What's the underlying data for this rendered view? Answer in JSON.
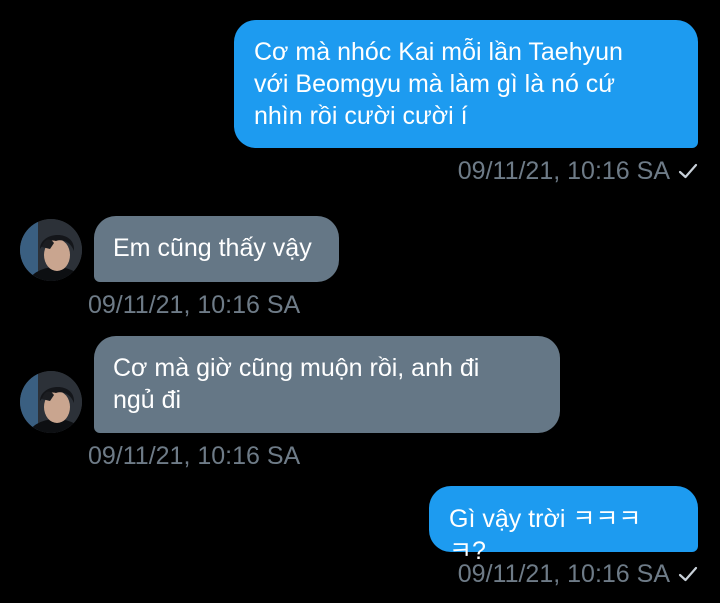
{
  "conversation": {
    "messages": [
      {
        "direction": "outgoing",
        "text": "Cơ mà nhóc Kai mỗi lần Taehyun với Beomgyu mà làm gì là nó cứ nhìn rồi cười cười í",
        "lines": [
          "Cơ mà nhóc Kai mỗi lần Taehyun",
          "với Beomgyu mà làm gì là nó cứ",
          "nhìn rồi cười cười í"
        ],
        "timestamp": "09/11/21, 10:16 SA",
        "read_icon": "checkmark-icon"
      },
      {
        "direction": "incoming",
        "text": "Em cũng thấy vậy",
        "timestamp": "09/11/21, 10:16 SA",
        "avatar_icon": "avatar"
      },
      {
        "direction": "incoming",
        "text": "Cơ mà giờ cũng muộn rồi, anh đi ngủ đi",
        "lines": [
          "Cơ mà giờ cũng muộn rồi, anh đi",
          "ngủ đi"
        ],
        "timestamp": "09/11/21, 10:16 SA",
        "avatar_icon": "avatar"
      },
      {
        "direction": "outgoing",
        "text": "Gì vậy trời ㅋㅋㅋㅋ?",
        "timestamp": "09/11/21, 10:16 SA",
        "read_icon": "checkmark-icon"
      }
    ]
  },
  "colors": {
    "background": "#000000",
    "outgoing_bubble": "#1d9bf0",
    "incoming_bubble": "#657786",
    "timestamp": "#6e7b87"
  }
}
